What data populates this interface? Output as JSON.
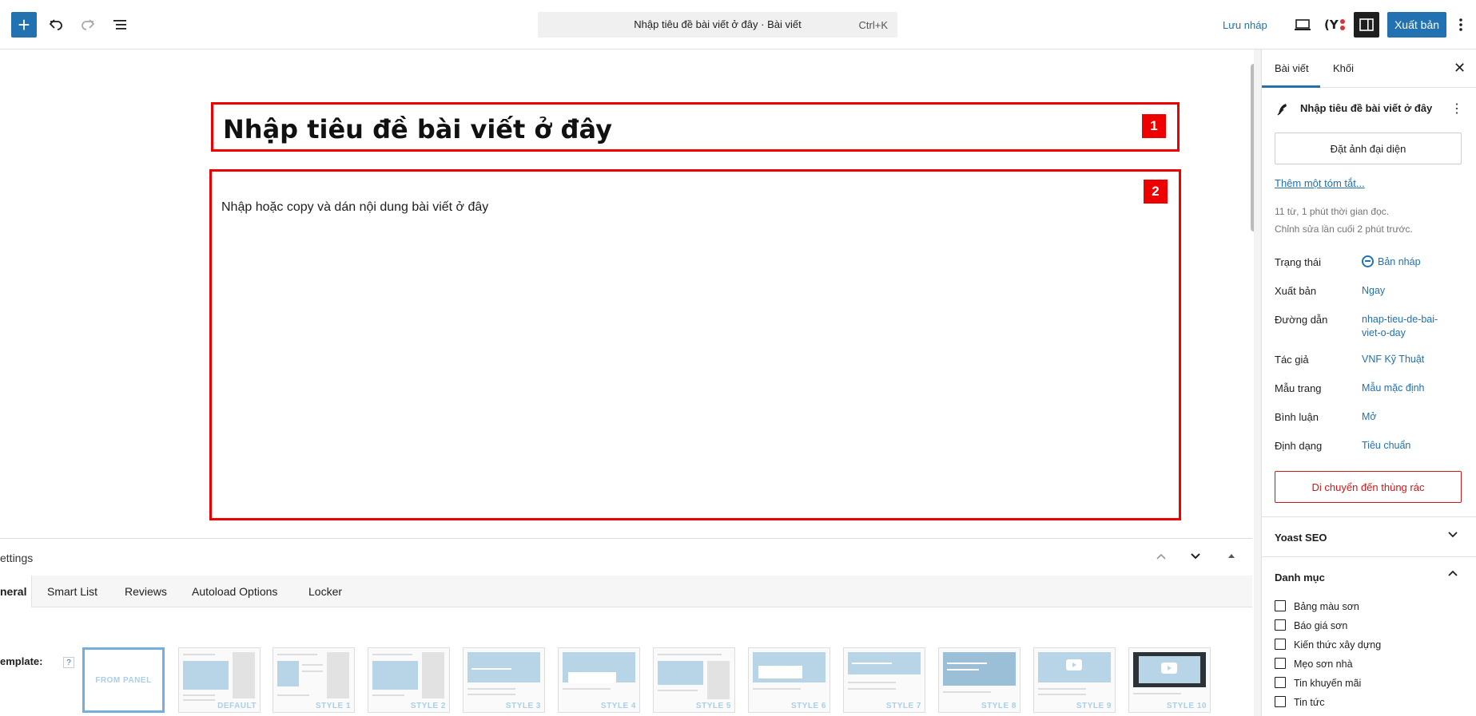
{
  "toolbar": {
    "add_label": "+",
    "command_title": "Nhập tiêu đề bài viết ở đây · Bài viết",
    "command_shortcut": "Ctrl+K",
    "save_draft": "Lưu nháp",
    "publish": "Xuất bản",
    "icons": [
      "plus-icon",
      "undo-icon",
      "redo-icon",
      "list-view-icon",
      "preview-icon",
      "yoast-icon",
      "settings-icon",
      "more-icon"
    ]
  },
  "editor": {
    "title": "Nhập tiêu đề bài viết ở đây",
    "content": "Nhập hoặc copy và dán nội dung bài viết ở đây",
    "badge_title": "1",
    "badge_content": "2"
  },
  "meta_panel": {
    "title": "ettings",
    "tabs": [
      "neral",
      "Smart List",
      "Reviews",
      "Autoload Options",
      "Locker"
    ],
    "template_label": "emplate:",
    "help": "?",
    "templates": [
      "FROM PANEL",
      "DEFAULT",
      "STYLE 1",
      "STYLE 2",
      "STYLE 3",
      "STYLE 4",
      "STYLE 5",
      "STYLE 6",
      "STYLE 7",
      "STYLE 8",
      "STYLE 9",
      "STYLE 10"
    ]
  },
  "sidebar": {
    "tabs": [
      "Bài viết",
      "Khối"
    ],
    "close": "✕",
    "post_title": "Nhập tiêu đề bài viết ở đây",
    "featured_image": "Đặt ảnh đại diện",
    "excerpt_link": "Thêm một tóm tắt...",
    "info_line1": "11 từ, 1 phút thời gian đọc.",
    "info_line2": "Chỉnh sửa lần cuối 2 phút trước.",
    "rows": [
      {
        "label": "Trạng thái",
        "value": "Bản nháp"
      },
      {
        "label": "Xuất bản",
        "value": "Ngay"
      },
      {
        "label": "Đường dẫn",
        "value": "nhap-tieu-de-bai-",
        "value2": "viet-o-day"
      },
      {
        "label": "Tác giả",
        "value": "VNF Kỹ Thuật"
      },
      {
        "label": "Mẫu trang",
        "value": "Mẫu mặc định"
      },
      {
        "label": "Bình luận",
        "value": "Mở"
      },
      {
        "label": "Định dạng",
        "value": "Tiêu chuẩn"
      }
    ],
    "trash": "Di chuyển đến thùng rác",
    "yoast_section": "Yoast SEO",
    "category_section": "Danh mục",
    "categories": [
      "Bảng màu sơn",
      "Báo giá sơn",
      "Kiến thức xây dựng",
      "Mẹo sơn nhà",
      "Tin khuyến mãi",
      "Tin tức"
    ]
  },
  "colors": {
    "accent": "#2271b1",
    "highlight": "#e00000",
    "danger": "#cc1818"
  }
}
